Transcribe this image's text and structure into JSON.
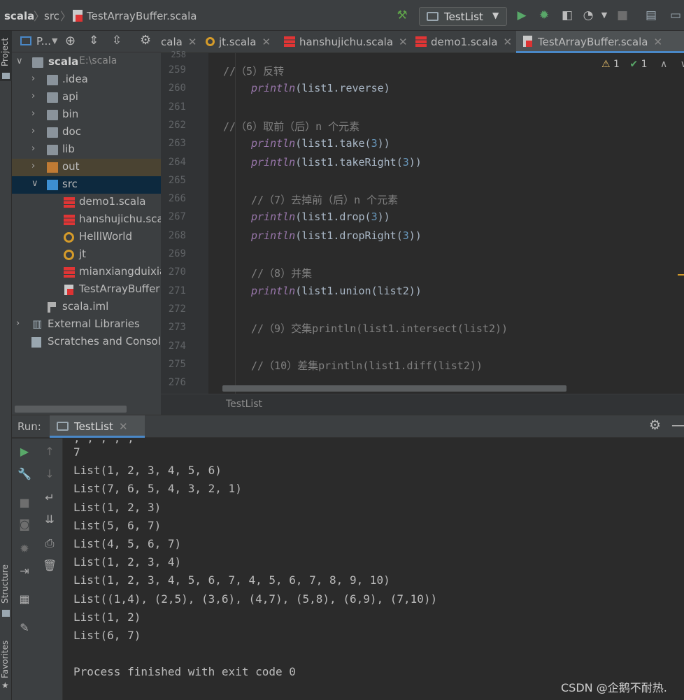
{
  "breadcrumb": {
    "project": "scala",
    "folder": "src",
    "file": "TestArrayBuffer.scala"
  },
  "toolbar": {
    "run_config": "TestList"
  },
  "side_labels": {
    "project": "Project",
    "structure": "Structure",
    "favorites": "Favorites"
  },
  "project_panel": {
    "view_label": "P...",
    "tree": [
      {
        "label": "scala",
        "path": "E:\\scala",
        "type": "project"
      },
      {
        "label": ".idea",
        "type": "folder"
      },
      {
        "label": "api",
        "type": "folder"
      },
      {
        "label": "bin",
        "type": "folder"
      },
      {
        "label": "doc",
        "type": "folder"
      },
      {
        "label": "lib",
        "type": "folder"
      },
      {
        "label": "out",
        "type": "folder-orange"
      },
      {
        "label": "src",
        "type": "folder-blue"
      },
      {
        "label": "demo1.scala",
        "type": "scala"
      },
      {
        "label": "hanshujichu.scala",
        "type": "scala"
      },
      {
        "label": "HelllWorld",
        "type": "object"
      },
      {
        "label": "jt",
        "type": "object"
      },
      {
        "label": "mianxiangduixia",
        "type": "scala"
      },
      {
        "label": "TestArrayBuffer",
        "type": "file"
      },
      {
        "label": "scala.iml",
        "type": "iml"
      },
      {
        "label": "External Libraries",
        "type": "lib"
      },
      {
        "label": "Scratches and Console",
        "type": "scratch"
      }
    ]
  },
  "editor_tabs": [
    {
      "label": "cala"
    },
    {
      "label": "jt.scala"
    },
    {
      "label": "hanshujichu.scala"
    },
    {
      "label": "demo1.scala"
    },
    {
      "label": "TestArrayBuffer.scala",
      "active": true
    }
  ],
  "inspections": {
    "warnings": "1",
    "ok": "1"
  },
  "editor": {
    "top_partial_line": "258",
    "lines": [
      {
        "n": "259",
        "parts": [
          {
            "t": "//（5）反转",
            "c": "cm"
          }
        ],
        "indent": 0
      },
      {
        "n": "260",
        "parts": [
          {
            "t": "println",
            "c": "fn"
          },
          {
            "t": "(list1.reverse)",
            "c": "tx"
          }
        ],
        "indent": 1
      },
      {
        "n": "261",
        "parts": [],
        "indent": 0
      },
      {
        "n": "262",
        "parts": [
          {
            "t": "//（6）取前（后）n 个元素",
            "c": "cm"
          }
        ],
        "indent": 0
      },
      {
        "n": "263",
        "parts": [
          {
            "t": "println",
            "c": "fn"
          },
          {
            "t": "(list1.take(",
            "c": "tx"
          },
          {
            "t": "3",
            "c": "num"
          },
          {
            "t": "))",
            "c": "tx"
          }
        ],
        "indent": 1
      },
      {
        "n": "264",
        "parts": [
          {
            "t": "println",
            "c": "fn"
          },
          {
            "t": "(list1.takeRight(",
            "c": "tx"
          },
          {
            "t": "3",
            "c": "num"
          },
          {
            "t": "))",
            "c": "tx"
          }
        ],
        "indent": 1
      },
      {
        "n": "265",
        "parts": [],
        "indent": 0
      },
      {
        "n": "266",
        "parts": [
          {
            "t": "//（7）去掉前（后）n 个元素",
            "c": "cm"
          }
        ],
        "indent": 1
      },
      {
        "n": "267",
        "parts": [
          {
            "t": "println",
            "c": "fn"
          },
          {
            "t": "(list1.drop(",
            "c": "tx"
          },
          {
            "t": "3",
            "c": "num"
          },
          {
            "t": "))",
            "c": "tx"
          }
        ],
        "indent": 1
      },
      {
        "n": "268",
        "parts": [
          {
            "t": "println",
            "c": "fn"
          },
          {
            "t": "(list1.dropRight(",
            "c": "tx"
          },
          {
            "t": "3",
            "c": "num"
          },
          {
            "t": "))",
            "c": "tx"
          }
        ],
        "indent": 1
      },
      {
        "n": "269",
        "parts": [],
        "indent": 0
      },
      {
        "n": "270",
        "parts": [
          {
            "t": "//（8）并集",
            "c": "cm"
          }
        ],
        "indent": 1
      },
      {
        "n": "271",
        "parts": [
          {
            "t": "println",
            "c": "fn"
          },
          {
            "t": "(list1.union(list2))",
            "c": "tx"
          }
        ],
        "indent": 1
      },
      {
        "n": "272",
        "parts": [],
        "indent": 0
      },
      {
        "n": "273",
        "parts": [
          {
            "t": "//（9）交集println(list1.intersect(list2))",
            "c": "cm"
          }
        ],
        "indent": 1
      },
      {
        "n": "274",
        "parts": [],
        "indent": 0
      },
      {
        "n": "275",
        "parts": [
          {
            "t": "//（10）差集println(list1.diff(list2))",
            "c": "cm"
          }
        ],
        "indent": 1
      },
      {
        "n": "276",
        "parts": [],
        "indent": 0
      }
    ],
    "footer_label": "TestList"
  },
  "run_panel": {
    "title": "Run:",
    "tab": "TestList",
    "output": [
      "7",
      "List(1, 2, 3, 4, 5, 6)",
      "List(7, 6, 5, 4, 3, 2, 1)",
      "List(1, 2, 3)",
      "List(5, 6, 7)",
      "List(4, 5, 6, 7)",
      "List(1, 2, 3, 4)",
      "List(1, 2, 3, 4, 5, 6, 7, 4, 5, 6, 7, 8, 9, 10)",
      "List((1,4), (2,5), (3,6), (4,7), (5,8), (6,9), (7,10))",
      "List(1, 2)",
      "List(6, 7)",
      "",
      "Process finished with exit code 0"
    ]
  },
  "watermark": "CSDN @企鹅不耐热."
}
